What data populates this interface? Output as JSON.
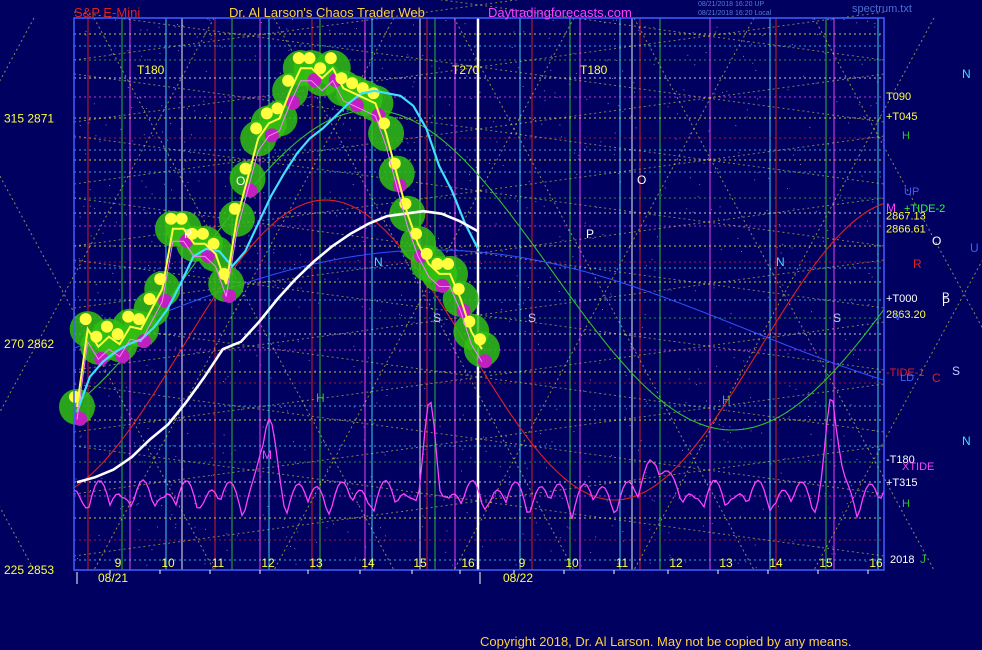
{
  "header": {
    "instrument": "S&P E-Mini",
    "site": "Dr. Al Larson's Chaos Trader Web",
    "url": "Daytradingforecasts.com",
    "update_1": "08/21/2018 16:20 UP",
    "update_2": "08/21/2018 16:20 Local",
    "file": "spectrum.txt"
  },
  "footer": {
    "copyright": "Copyright 2018, Dr. Al Larson. May not be copied by any means."
  },
  "colors": {
    "background": "#000060",
    "price": "#ffff40",
    "fast_average": "#40e0ff",
    "slow_average": "#ffffff",
    "glow": "#30c010",
    "blob": "#c020c0",
    "tide": "#ff40ff",
    "green_wave": "#30c030",
    "red_wave": "#e02020"
  },
  "chart_data": {
    "type": "line",
    "title": "S&P E-Mini",
    "y_axis": {
      "range": [
        2853,
        2875
      ],
      "tick_labels": [
        {
          "value": 2871,
          "label": "315  2871"
        },
        {
          "value": 2862,
          "label": "270  2862"
        },
        {
          "value": 2853,
          "label": "225  2853"
        }
      ]
    },
    "x_axis": {
      "hour_ticks": [
        "9",
        "10",
        "11",
        "12",
        "13",
        "14",
        "15",
        "16",
        "9",
        "10",
        "11",
        "12",
        "13",
        "14",
        "15",
        "16"
      ],
      "date_labels": [
        "08/21",
        "08/22"
      ]
    },
    "right_price_labels": [
      {
        "value": 2867.13,
        "label": "2867.13"
      },
      {
        "value": 2866.61,
        "label": "2866.61"
      },
      {
        "value": 2863.2,
        "label": "2863.20"
      }
    ],
    "right_line_labels": [
      "T090",
      "+T045",
      "H",
      "UP",
      "+TIDE-2",
      "P",
      "+T000",
      "V",
      "-TIDE-1",
      "LD",
      "-T180",
      "XTIDE",
      "+T315",
      "H",
      "2018"
    ],
    "planet_markers": [
      "N",
      "O",
      "U",
      "P",
      "S",
      "N",
      "M",
      "R",
      "C",
      "J"
    ],
    "top_labels": [
      "T180",
      "T270",
      "T180"
    ],
    "series": [
      {
        "name": "price",
        "y": [
          2859.5,
          2862.6,
          2861.9,
          2862.3,
          2862.0,
          2862.7,
          2862.6,
          2863.4,
          2864.2,
          2866.6,
          2866.6,
          2866.0,
          2866.0,
          2865.6,
          2864.4,
          2867.0,
          2868.6,
          2870.2,
          2870.8,
          2871.0,
          2872.1,
          2873.0,
          2873.0,
          2872.6,
          2873.0,
          2872.2,
          2872.0,
          2871.8,
          2871.6,
          2870.4,
          2868.8,
          2867.2,
          2866.0,
          2865.2,
          2864.8,
          2864.8,
          2863.8,
          2862.5,
          2861.8
        ]
      },
      {
        "name": "fast average",
        "y": [
          2859.3,
          2860.7,
          2861.3,
          2861.7,
          2862.0,
          2862.2,
          2862.7,
          2863.4,
          2864.4,
          2865.5,
          2865.8,
          2865.7,
          2865.1,
          2865.7,
          2866.8,
          2867.9,
          2868.8,
          2869.6,
          2870.2,
          2870.6,
          2871.1,
          2871.6,
          2872.0,
          2872.1,
          2872.0,
          2871.9,
          2871.5,
          2870.6,
          2869.1,
          2868.1,
          2866.8,
          2865.8
        ]
      },
      {
        "name": "slow average",
        "y": [
          2856.5,
          2856.7,
          2857.0,
          2857.5,
          2858.2,
          2858.8,
          2859.7,
          2860.7,
          2861.8,
          2862.1,
          2862.9,
          2863.8,
          2864.6,
          2865.3,
          2865.9,
          2866.4,
          2866.8,
          2867.1,
          2867.2,
          2867.3,
          2867.2,
          2866.9,
          2866.5
        ]
      }
    ]
  }
}
